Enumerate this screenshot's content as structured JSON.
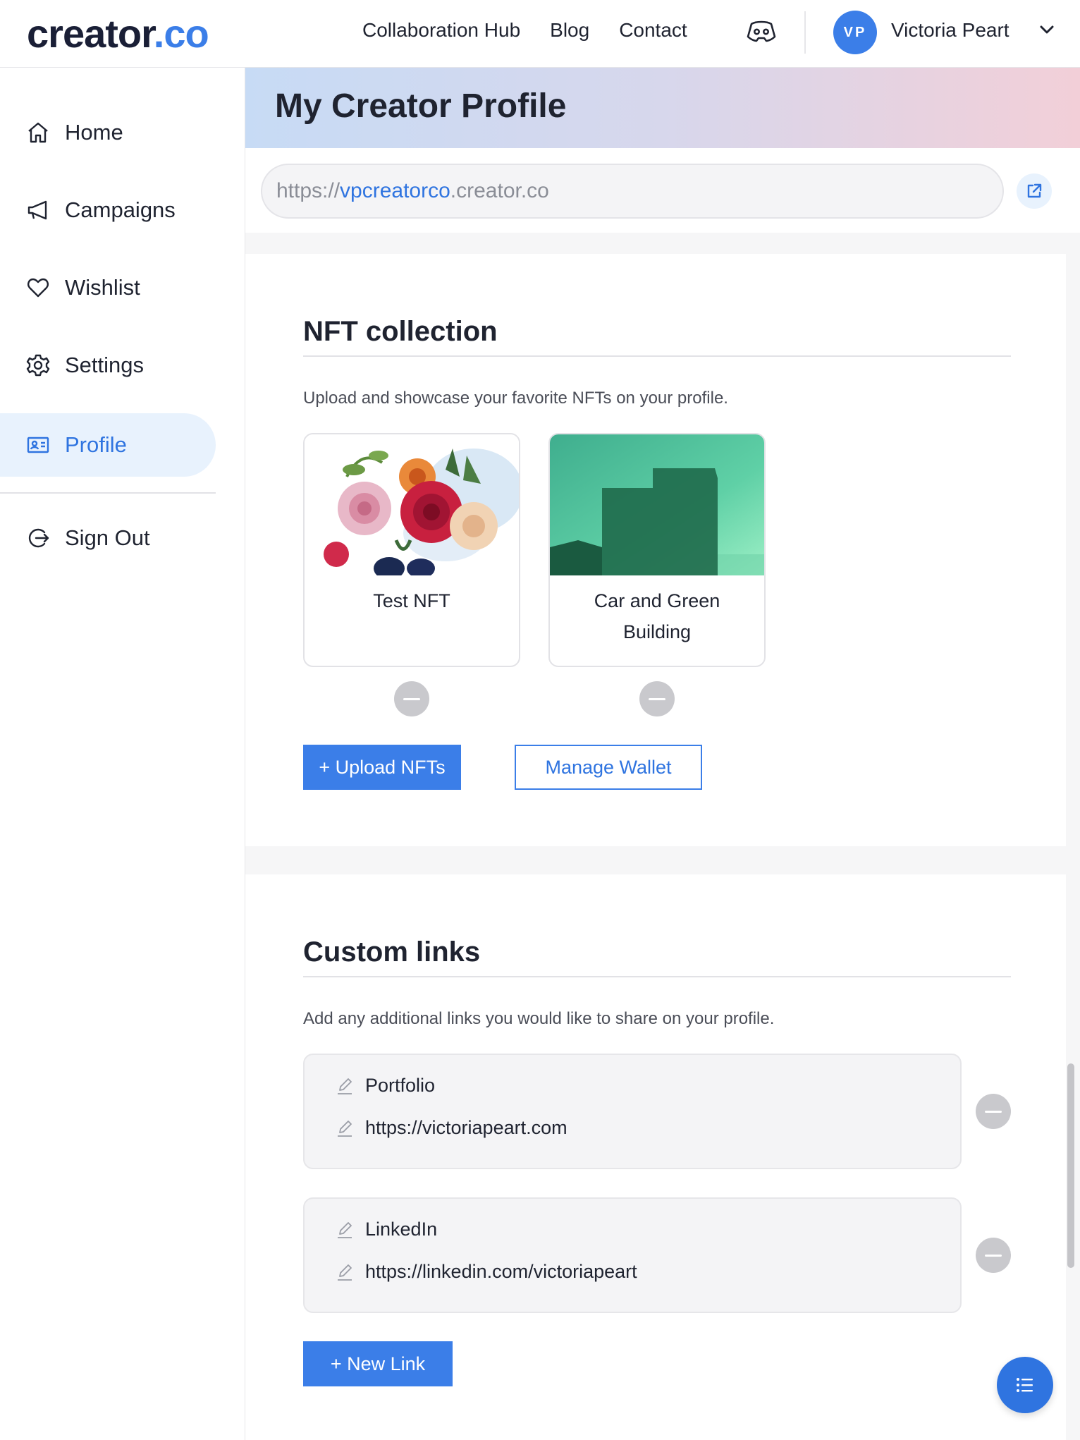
{
  "header": {
    "logo_text": "creator",
    "logo_suffix": ".co",
    "nav": [
      "Collaboration Hub",
      "Blog",
      "Contact"
    ],
    "discord_icon": "discord-icon",
    "avatar_initials": "VP",
    "user_name": "Victoria Peart"
  },
  "sidebar": {
    "items": [
      {
        "label": "Home",
        "icon": "home-icon"
      },
      {
        "label": "Campaigns",
        "icon": "megaphone-icon"
      },
      {
        "label": "Wishlist",
        "icon": "heart-icon"
      },
      {
        "label": "Settings",
        "icon": "gear-icon"
      },
      {
        "label": "Profile",
        "icon": "id-card-icon",
        "active": true
      },
      {
        "label": "Sign Out",
        "icon": "sign-out-icon"
      }
    ]
  },
  "page": {
    "title": "My Creator Profile",
    "url_prefix": "https://",
    "url_handle": "vpcreatorco",
    "url_suffix": ".creator.co"
  },
  "nft": {
    "heading": "NFT collection",
    "description": "Upload and showcase your favorite NFTs on your profile.",
    "items": [
      {
        "title": "Test NFT"
      },
      {
        "title": "Car and Green Building"
      }
    ],
    "upload_label": "+ Upload NFTs",
    "manage_label": "Manage Wallet"
  },
  "links": {
    "heading": "Custom links",
    "description": "Add any additional links you would like to share on your profile.",
    "items": [
      {
        "title": "Portfolio",
        "url": "https://victoriapeart.com"
      },
      {
        "title": "LinkedIn",
        "url": "https://linkedin.com/victoriapeart"
      }
    ],
    "new_label": "+ New Link"
  },
  "colors": {
    "accent": "#3b7ee8",
    "active_bg": "#e8f2fd"
  }
}
